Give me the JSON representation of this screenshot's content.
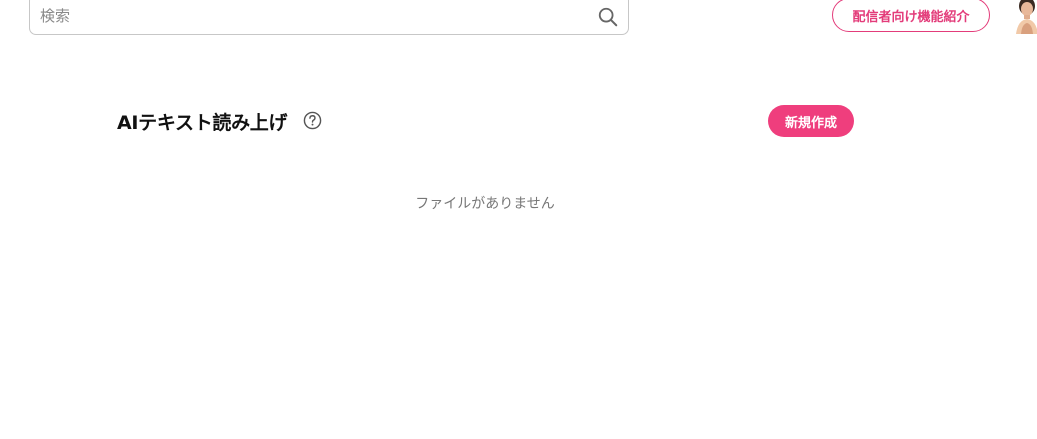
{
  "header": {
    "search": {
      "placeholder": "検索",
      "value": ""
    },
    "feature_button_label": "配信者向け機能紹介"
  },
  "main": {
    "title": "AIテキスト読み上げ",
    "new_button_label": "新規作成",
    "empty_message": "ファイルがありません"
  },
  "colors": {
    "accent": "#ef3e7d",
    "accent_outline": "#e33c7a",
    "muted_text": "#777777"
  },
  "icons": {
    "search": "search-icon",
    "help": "help-icon",
    "avatar": "user-avatar"
  }
}
